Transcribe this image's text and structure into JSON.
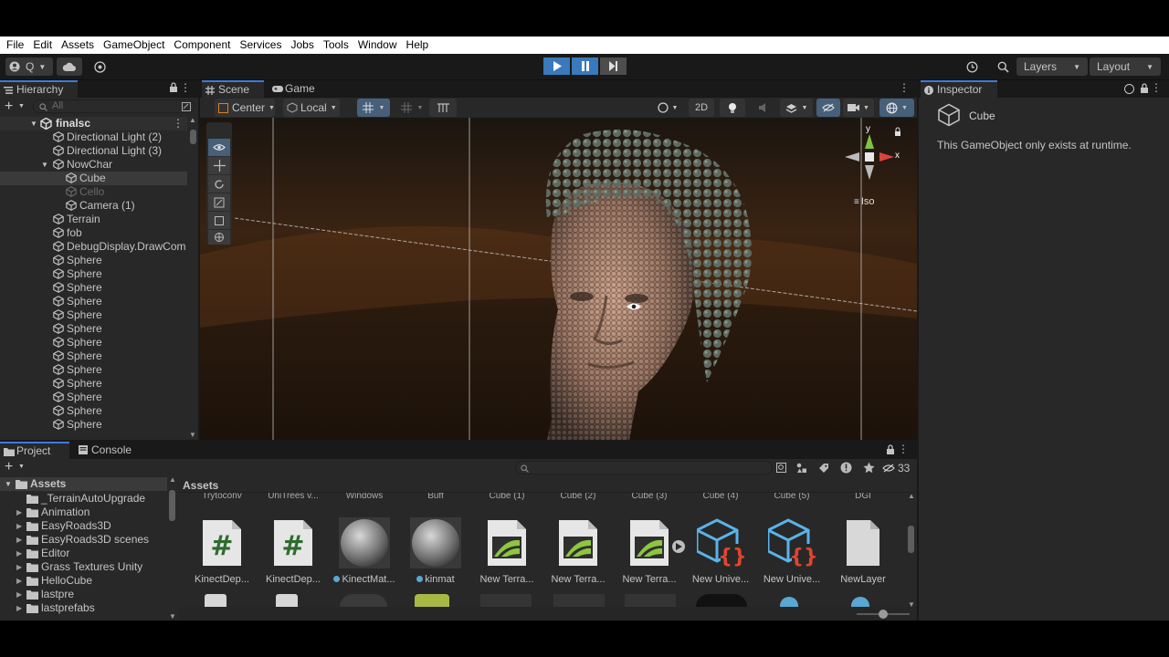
{
  "menu": [
    "File",
    "Edit",
    "Assets",
    "GameObject",
    "Component",
    "Services",
    "Jobs",
    "Tools",
    "Window",
    "Help"
  ],
  "toolbar": {
    "account_label": "Q",
    "layers_label": "Layers",
    "layout_label": "Layout"
  },
  "hierarchy": {
    "tab_label": "Hierarchy",
    "search_placeholder": "All",
    "scene_name": "finalsc",
    "items": [
      {
        "label": "Directional Light (2)",
        "indent": 2,
        "dim": false
      },
      {
        "label": "Directional Light (3)",
        "indent": 2,
        "dim": false
      },
      {
        "label": "NowChar",
        "indent": 2,
        "dim": false,
        "expanded": true
      },
      {
        "label": "Cube",
        "indent": 3,
        "dim": false,
        "selected": true
      },
      {
        "label": "Cello",
        "indent": 3,
        "dim": true
      },
      {
        "label": "Camera (1)",
        "indent": 3,
        "dim": false
      },
      {
        "label": "Terrain",
        "indent": 2,
        "dim": false
      },
      {
        "label": "fob",
        "indent": 2,
        "dim": false
      },
      {
        "label": "DebugDisplay.DrawCom",
        "indent": 2,
        "dim": false
      },
      {
        "label": "Sphere",
        "indent": 2,
        "dim": false
      },
      {
        "label": "Sphere",
        "indent": 2,
        "dim": false
      },
      {
        "label": "Sphere",
        "indent": 2,
        "dim": false
      },
      {
        "label": "Sphere",
        "indent": 2,
        "dim": false
      },
      {
        "label": "Sphere",
        "indent": 2,
        "dim": false
      },
      {
        "label": "Sphere",
        "indent": 2,
        "dim": false
      },
      {
        "label": "Sphere",
        "indent": 2,
        "dim": false
      },
      {
        "label": "Sphere",
        "indent": 2,
        "dim": false
      },
      {
        "label": "Sphere",
        "indent": 2,
        "dim": false
      },
      {
        "label": "Sphere",
        "indent": 2,
        "dim": false
      },
      {
        "label": "Sphere",
        "indent": 2,
        "dim": false
      },
      {
        "label": "Sphere",
        "indent": 2,
        "dim": false
      },
      {
        "label": "Sphere",
        "indent": 2,
        "dim": false
      }
    ]
  },
  "scene": {
    "tabs": [
      "Scene",
      "Game"
    ],
    "pivot_label": "Center",
    "space_label": "Local",
    "mode_2d": "2D",
    "gizmo_axes": {
      "y": "y",
      "x": "x"
    },
    "projection_label": "Iso"
  },
  "inspector": {
    "tab_label": "Inspector",
    "object_name": "Cube",
    "message": "This GameObject only exists at runtime."
  },
  "project": {
    "tabs": [
      "Project",
      "Console"
    ],
    "root_label": "Assets",
    "breadcrumb": "Assets",
    "hidden_count": "33",
    "folders": [
      "_TerrainAutoUpgrade",
      "Animation",
      "EasyRoads3D",
      "EasyRoads3D scenes",
      "Editor",
      "Grass Textures Unity",
      "HelloCube",
      "lastpre",
      "lastprefabs"
    ],
    "top_row_labels": [
      "Trytoconv",
      "UniTrees v...",
      "Windows",
      "Buff",
      "Cube (1)",
      "Cube (2)",
      "Cube (3)",
      "Cube (4)",
      "Cube (5)",
      "DGI"
    ],
    "assets": [
      {
        "label": "KinectDep...",
        "icon": "script-icon"
      },
      {
        "label": "KinectDep...",
        "icon": "script-icon"
      },
      {
        "label": "KinectMat...",
        "icon": "material-sphere-icon"
      },
      {
        "label": "kinmat",
        "icon": "material-sphere-icon"
      },
      {
        "label": "New Terra...",
        "icon": "terrain-layer-icon"
      },
      {
        "label": "New Terra...",
        "icon": "terrain-layer-icon"
      },
      {
        "label": "New Terra...",
        "icon": "terrain-layer-icon"
      },
      {
        "label": "New Unive...",
        "icon": "prefab-script-icon"
      },
      {
        "label": "New Unive...",
        "icon": "prefab-script-icon"
      },
      {
        "label": "NewLayer",
        "icon": "blank-file-icon"
      }
    ]
  },
  "colors": {
    "accent": "#3a79bb",
    "tab_underline": "#3d7ae0",
    "panel": "#282828",
    "background": "#191919"
  }
}
